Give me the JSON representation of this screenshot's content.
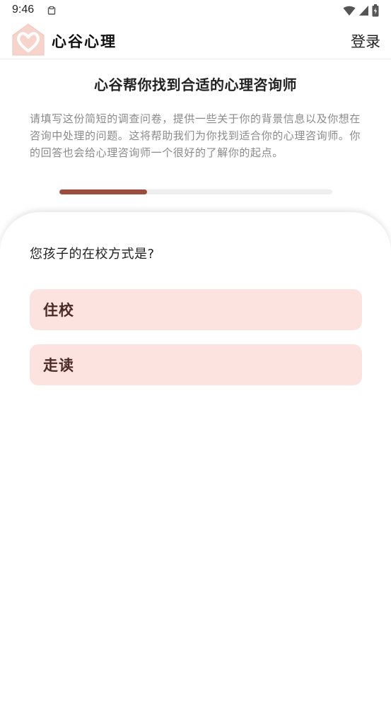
{
  "status_bar": {
    "time": "9:46"
  },
  "header": {
    "brand": "心谷心理",
    "login_label": "登录"
  },
  "intro": {
    "title": "心谷帮你找到合适的心理咨询师",
    "description": "请填写这份简短的调查问卷，提供一些关于你的背景信息以及你想在咨询中处理的问题。这将帮助我们为你找到适合你的心理咨询师。你的回答也会给心理咨询师一个很好的了解你的起点。"
  },
  "progress": {
    "fraction": 0.32
  },
  "question": {
    "text": "您孩子的在校方式是?",
    "options": [
      {
        "label": "住校"
      },
      {
        "label": "走读"
      }
    ]
  },
  "colors": {
    "accent": "#9a4f3e",
    "option_bg": "#fde3df",
    "option_text": "#4a2a26",
    "logo_bg": "#f6d3cb"
  },
  "icons": {
    "status_notification": "clipboard-icon",
    "wifi": "wifi-icon",
    "signal": "signal-icon",
    "battery": "battery-charging-icon",
    "logo": "heart-house-logo"
  }
}
